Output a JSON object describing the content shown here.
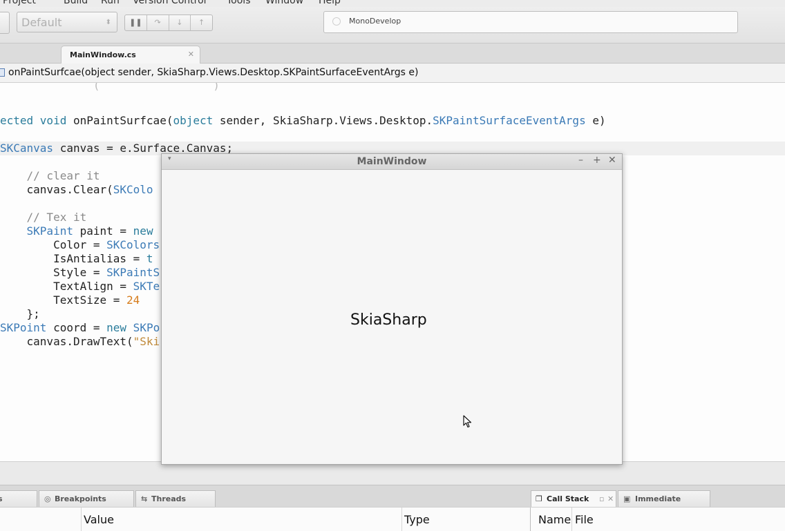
{
  "menubar": {
    "items": [
      "Project",
      "Build",
      "Run",
      "Version Control",
      "Tools",
      "Window",
      "Help"
    ]
  },
  "toolbar": {
    "config_value": "Default",
    "status_text": "MonoDevelop"
  },
  "tabs": {
    "active_label": "MainWindow.cs"
  },
  "breadcrumb": {
    "text": "onPaintSurfcae(object sender, SkiaSharp.Views.Desktop.SKPaintSurfaceEventArgs e)"
  },
  "code": {
    "signature_prefix": "ected ",
    "signature_void": "void",
    "signature_name": " onPaintSurfcae(",
    "signature_object": "object",
    "signature_mid": " sender, SkiaSharp.Views.Desktop.",
    "signature_type": "SKPaintSurfaceEventArgs",
    "signature_end": " e)",
    "line_canvas_type": "SKCanvas",
    "line_canvas_rest": " canvas = e.Surface.Canvas;",
    "comment_clear": "    // clear it",
    "line_clear_a": "    canvas.Clear(",
    "line_clear_b": "SKColo",
    "comment_text": "    // Tex it",
    "line_paint_indent": "    ",
    "line_paint_type": "SKPaint",
    "line_paint_rest": " paint = ",
    "line_paint_new": "new",
    "line_color_a": "        Color = ",
    "line_color_b": "SKColors",
    "line_aa_a": "        IsAntialias = ",
    "line_aa_b": "t",
    "line_style_a": "        Style = ",
    "line_style_b": "SKPaintS",
    "line_align_a": "        TextAlign = ",
    "line_align_b": "SKTe",
    "line_size_a": "        TextSize = ",
    "line_size_b": "24",
    "line_close": "    };",
    "line_point_type": "SKPoint",
    "line_point_rest": " coord = ",
    "line_point_new": "new",
    "line_point_b": " SKPo",
    "line_draw_a": "    canvas.DrawText(",
    "line_draw_b": "\"Ski"
  },
  "pads": {
    "breakpoints": "Breakpoints",
    "threads": "Threads",
    "call_stack": "Call Stack",
    "immediate": "Immediate",
    "col_value": "Value",
    "col_type": "Type",
    "col_name": "Name",
    "col_file": "File"
  },
  "main_window": {
    "title": "MainWindow",
    "content_text": "SkiaSharp"
  }
}
